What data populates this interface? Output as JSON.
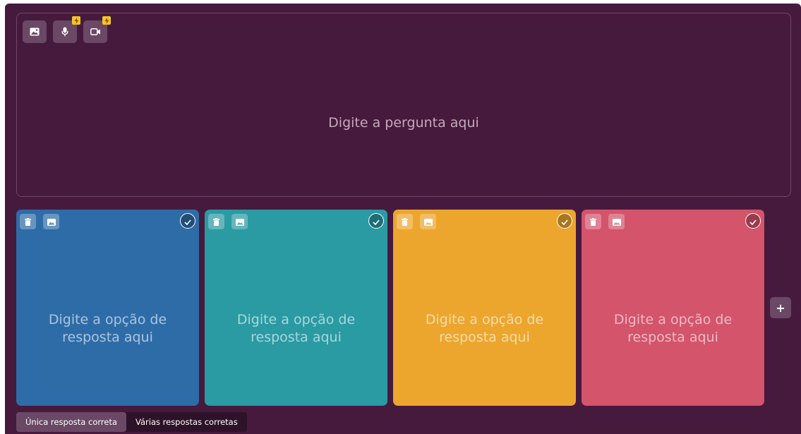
{
  "question": {
    "placeholder": "Digite a pergunta aqui",
    "media_buttons": [
      {
        "icon": "image-icon",
        "locked": false
      },
      {
        "icon": "microphone-icon",
        "locked": true,
        "badge_icon": "lightning-icon"
      },
      {
        "icon": "video-icon",
        "locked": true,
        "badge_icon": "lightning-icon"
      }
    ]
  },
  "options": [
    {
      "placeholder": "Digite a opção de resposta aqui",
      "color": "#2e6ca8"
    },
    {
      "placeholder": "Digite a opção de resposta aqui",
      "color": "#2a9aa3"
    },
    {
      "placeholder": "Digite a opção de resposta aqui",
      "color": "#eca62d"
    },
    {
      "placeholder": "Digite a opção de resposta aqui",
      "color": "#d3546b"
    }
  ],
  "option_buttons": {
    "delete_icon": "trash-icon",
    "image_icon": "image-icon",
    "correct_icon": "check-icon"
  },
  "add_option_icon": "plus-icon",
  "add_option_label": "+",
  "answer_mode": {
    "single": "Única resposta correta",
    "multiple": "Várias respostas corretas",
    "selected": "single"
  },
  "colors": {
    "background": "#461a3d",
    "button": "#6a4866",
    "badge": "#f5c623"
  }
}
